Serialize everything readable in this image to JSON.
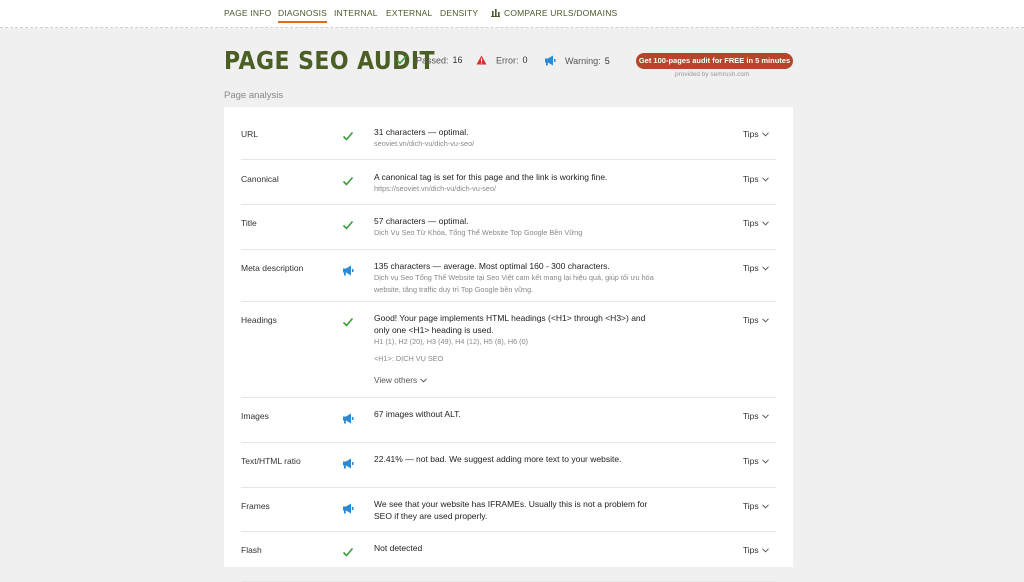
{
  "nav": {
    "tabs": [
      {
        "label": "PAGE INFO"
      },
      {
        "label": "DIAGNOSIS"
      },
      {
        "label": "INTERNAL"
      },
      {
        "label": "EXTERNAL"
      },
      {
        "label": "DENSITY"
      },
      {
        "label": "COMPARE URLS/DOMAINS",
        "icon": "bar-chart-icon"
      }
    ],
    "active": "DIAGNOSIS"
  },
  "header": {
    "title": "PAGE SEO AUDIT",
    "passed_label": "Passed:",
    "passed_value": "16",
    "error_label": "Error:",
    "error_value": "0",
    "warning_label": "Warning:",
    "warning_value": "5",
    "cta_label": "Get 100-pages audit for FREE in 5 minutes",
    "provided_by": "provided by  semrush.com"
  },
  "section_label": "Page analysis",
  "tips_label": "Tips",
  "rows": [
    {
      "label": "URL",
      "status": "pass",
      "text": "31 characters — optimal.",
      "sub": "seoviet.vn/dich-vu/dich-vu-seo/"
    },
    {
      "label": "Canonical",
      "status": "pass",
      "text": "A canonical tag is set for this page and the link is working fine.",
      "sub": "https://seoviet.vn/dich-vu/dich-vu-seo/"
    },
    {
      "label": "Title",
      "status": "pass",
      "text": "57 characters — optimal.",
      "sub": "Dịch Vụ Seo Từ Khóa, Tổng Thể Website Top Google Bền Vững"
    },
    {
      "label": "Meta description",
      "status": "warning",
      "text": "135 characters — average. Most optimal 160 - 300 characters.",
      "sub": "Dịch vụ Seo Tổng Thể Website tại Seo Việt cam kết mang lại hiệu quả, giúp tối ưu hóa website, tăng traffic duy trì Top Google bền vững."
    },
    {
      "label": "Headings",
      "status": "pass",
      "text": "Good! Your page implements HTML headings (<H1> through <H3>) and only one <H1> heading is used.",
      "sub": "H1 (1), H2 (20), H3 (49), H4 (12), H5 (8), H6 (0)",
      "extra": "<H1>: DỊCH VỤ SEO",
      "view_others": "View others"
    },
    {
      "label": "Images",
      "status": "warning",
      "text": "67 images without ALT.",
      "sub": ""
    },
    {
      "label": "Text/HTML ratio",
      "status": "warning",
      "text": "22.41% — not bad. We suggest adding more text to your website.",
      "sub": ""
    },
    {
      "label": "Frames",
      "status": "warning",
      "text": "We see that your website has IFRAMEs. Usually this is not a problem for SEO if they are used properly.",
      "sub": ""
    },
    {
      "label": "Flash",
      "status": "pass",
      "text": "Not detected",
      "sub": ""
    }
  ],
  "colors": {
    "accent": "#e06a1b",
    "title": "#4b5e23",
    "pass": "#3a9b3a",
    "error": "#d9302c",
    "warning": "#2b8ad6",
    "cta": "#b5452b"
  }
}
